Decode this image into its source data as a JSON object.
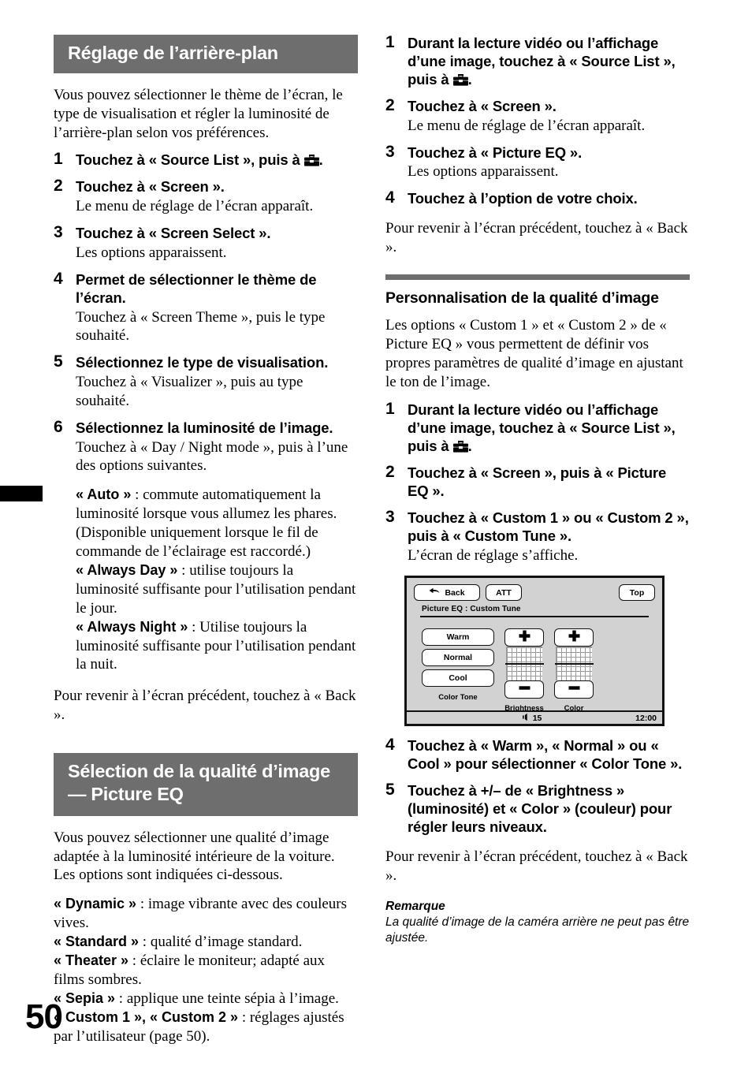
{
  "page": {
    "number": "50"
  },
  "left_column": {
    "section1": {
      "band_title": "Réglage de l’arrière-plan",
      "intro": "Vous pouvez sélectionner le thème de l’écran, le type de visualisation et régler la luminosité de l’arrière-plan selon vos préférences.",
      "steps": [
        {
          "num": "1",
          "head_before_icon": "Touchez à « Source List », puis à ",
          "head_after_icon": ".",
          "has_icon": true,
          "sub": ""
        },
        {
          "num": "2",
          "head": "Touchez à « Screen ».",
          "sub": "Le menu de réglage de l’écran apparaît."
        },
        {
          "num": "3",
          "head": "Touchez à « Screen Select ».",
          "sub": "Les options apparaissent."
        },
        {
          "num": "4",
          "head": "Permet de sélectionner le thème de l’écran.",
          "sub": "Touchez à « Screen Theme », puis le type souhaité."
        },
        {
          "num": "5",
          "head": "Sélectionnez le type de visualisation.",
          "sub": "Touchez à « Visualizer », puis au type souhaité."
        },
        {
          "num": "6",
          "head": "Sélectionnez la luminosité de l’image.",
          "sub": "Touchez à « Day / Night mode », puis à l’une des options suivantes."
        }
      ],
      "options": [
        {
          "term": "« Auto »",
          "sep": " : ",
          "desc": "commute automatiquement la luminosité lorsque vous allumez les phares. (Disponible uniquement lorsque le fil de commande de l’éclairage est raccordé.)"
        },
        {
          "term": "« Always Day »",
          "sep": " : ",
          "desc": "utilise toujours la luminosité suffisante pour l’utilisation pendant le jour."
        },
        {
          "term": "« Always Night »",
          "sep": " : ",
          "desc": "Utilise toujours la luminosité suffisante pour l’utilisation pendant la nuit."
        }
      ],
      "closing": "Pour revenir à l’écran précédent, touchez à « Back »."
    },
    "section2": {
      "band_title_line1": "Sélection de la qualité d’image",
      "band_title_line2": "— Picture EQ",
      "intro": "Vous pouvez sélectionner une qualité d’image adaptée à la luminosité intérieure de la voiture. Les options sont indiquées ci-dessous.",
      "options": [
        {
          "term": "« Dynamic »",
          "sep": " : ",
          "desc": "image vibrante avec des couleurs vives."
        },
        {
          "term": "« Standard »",
          "sep": " : ",
          "desc": "qualité d’image standard."
        },
        {
          "term": "« Theater »",
          "sep": " : ",
          "desc": "éclaire le moniteur; adapté aux films sombres."
        },
        {
          "term": "« Sepia »",
          "sep": " : ",
          "desc": "applique une teinte sépia à l’image."
        },
        {
          "term": "« Custom 1 », « Custom 2 »",
          "sep": " : ",
          "desc": "réglages ajustés par l’utilisateur (page 50)."
        }
      ]
    }
  },
  "right_column": {
    "picture_eq_steps": [
      {
        "num": "1",
        "head_before_icon": "Durant la lecture vidéo ou l’affichage d’une image, touchez à « Source List », puis à ",
        "head_after_icon": ".",
        "has_icon": true,
        "sub": ""
      },
      {
        "num": "2",
        "head": "Touchez à « Screen ».",
        "sub": "Le menu de réglage de l’écran apparaît."
      },
      {
        "num": "3",
        "head": "Touchez à « Picture EQ ».",
        "sub": "Les options apparaissent."
      },
      {
        "num": "4",
        "head": "Touchez à l’option de votre choix.",
        "sub": ""
      }
    ],
    "closing1": "Pour revenir à l’écran précédent, touchez à « Back ».",
    "subhead": "Personnalisation de la qualité d’image",
    "intro": "Les options « Custom 1 » et « Custom 2 » de « Picture EQ » vous permettent de définir vos propres paramètres de qualité d’image en ajustant le ton de l’image.",
    "custom_steps": [
      {
        "num": "1",
        "head_before_icon": "Durant la lecture vidéo ou l’affichage d’une image, touchez à « Source List », puis à ",
        "head_after_icon": ".",
        "has_icon": true,
        "sub": ""
      },
      {
        "num": "2",
        "head": "Touchez à « Screen », puis à « Picture EQ ».",
        "sub": ""
      },
      {
        "num": "3",
        "head": "Touchez à « Custom 1 » ou « Custom 2 », puis à « Custom Tune ».",
        "sub": "L’écran de réglage s’affiche."
      }
    ],
    "custom_steps_after": [
      {
        "num": "4",
        "head": "Touchez à « Warm », « Normal » ou « Cool » pour sélectionner « Color Tone ».",
        "sub": ""
      },
      {
        "num": "5",
        "head": "Touchez à +/– de « Brightness » (luminosité) et « Color » (couleur) pour régler leurs niveaux.",
        "sub": ""
      }
    ],
    "closing2": "Pour revenir à l’écran précédent, touchez à « Back ».",
    "note_title": "Remarque",
    "note_body": "La qualité d’image de la caméra arrière ne peut pas être ajustée."
  },
  "figure": {
    "back_button": "Back",
    "att_button": "ATT",
    "top_button": "Top",
    "title": "Picture EQ : Custom Tune",
    "tone_buttons": [
      "Warm",
      "Normal",
      "Cool"
    ],
    "tone_label": "Color Tone",
    "sliders": [
      {
        "label": "Brightness",
        "value": "0",
        "plus": "+",
        "minus": "−"
      },
      {
        "label": "Color",
        "value": "0",
        "plus": "+",
        "minus": "−"
      }
    ],
    "volume": "15",
    "clock": "12:00"
  },
  "colors": {
    "band_gray": "#6e6e6e",
    "figure_bg": "#d2d2d2",
    "ink": "#000000"
  }
}
